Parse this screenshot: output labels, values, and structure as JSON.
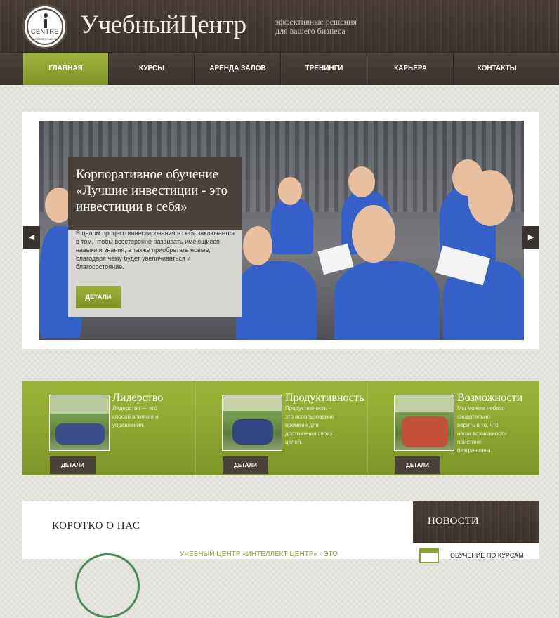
{
  "header": {
    "logo": {
      "word": "CENTRE",
      "sub": "ИНТЕЛЛЕКТ ЦЕНТР"
    },
    "title": "УчебныйЦентр",
    "tagline_line1": "эффективные решения",
    "tagline_line2": "для вашего бизнеса"
  },
  "nav": {
    "items": [
      {
        "label": "ГЛАВНАЯ",
        "active": true
      },
      {
        "label": "КУРСЫ",
        "active": false
      },
      {
        "label": "АРЕНДА ЗАЛОВ",
        "active": false
      },
      {
        "label": "ТРЕНИНГИ",
        "active": false
      },
      {
        "label": "КАРЬЕРА",
        "active": false
      },
      {
        "label": "КОНТАКТЫ",
        "active": false
      }
    ]
  },
  "slider": {
    "caption_title": "Корпоративное обучение «Лучшие инвестиции - это инвестиции в себя»",
    "caption_text": "В целом процесс инвестирования в себя заключается в том, чтобы всесторонне развивать имеющиеся навыки и знания, а также приобретать новые, благодаря чему будет увеличиваться и благосостояние.",
    "button_label": "ДЕТАЛИ",
    "prev_icon": "◀",
    "next_icon": "▶"
  },
  "features": [
    {
      "title": "Лидерство",
      "text": "Лидерство — это способ влияния и управления.",
      "button_label": "ДЕТАЛИ"
    },
    {
      "title": "Продуктивность",
      "text": "Продуктивность – это использование времени для достижения своих целей.",
      "button_label": "ДЕТАЛИ"
    },
    {
      "title": "Возможности",
      "text": "Мы можем небезо сновательно верить в то, что наши возможности поистине безграничны.",
      "button_label": "ДЕТАЛИ"
    }
  ],
  "about": {
    "title": "КОРОТКО О НАС",
    "text": "УЧЕБНЫЙ ЦЕНТР «ИНТЕЛЛЕКТ ЦЕНТР» - ЭТО"
  },
  "news": {
    "title": "НОВОСТИ",
    "items": [
      {
        "label": "ОБУЧЕНИЕ ПО КУРСАМ"
      }
    ]
  },
  "colors": {
    "accent_green": "#8aa030",
    "dark_brown": "#4a413a",
    "background": "#e9e7e1"
  }
}
